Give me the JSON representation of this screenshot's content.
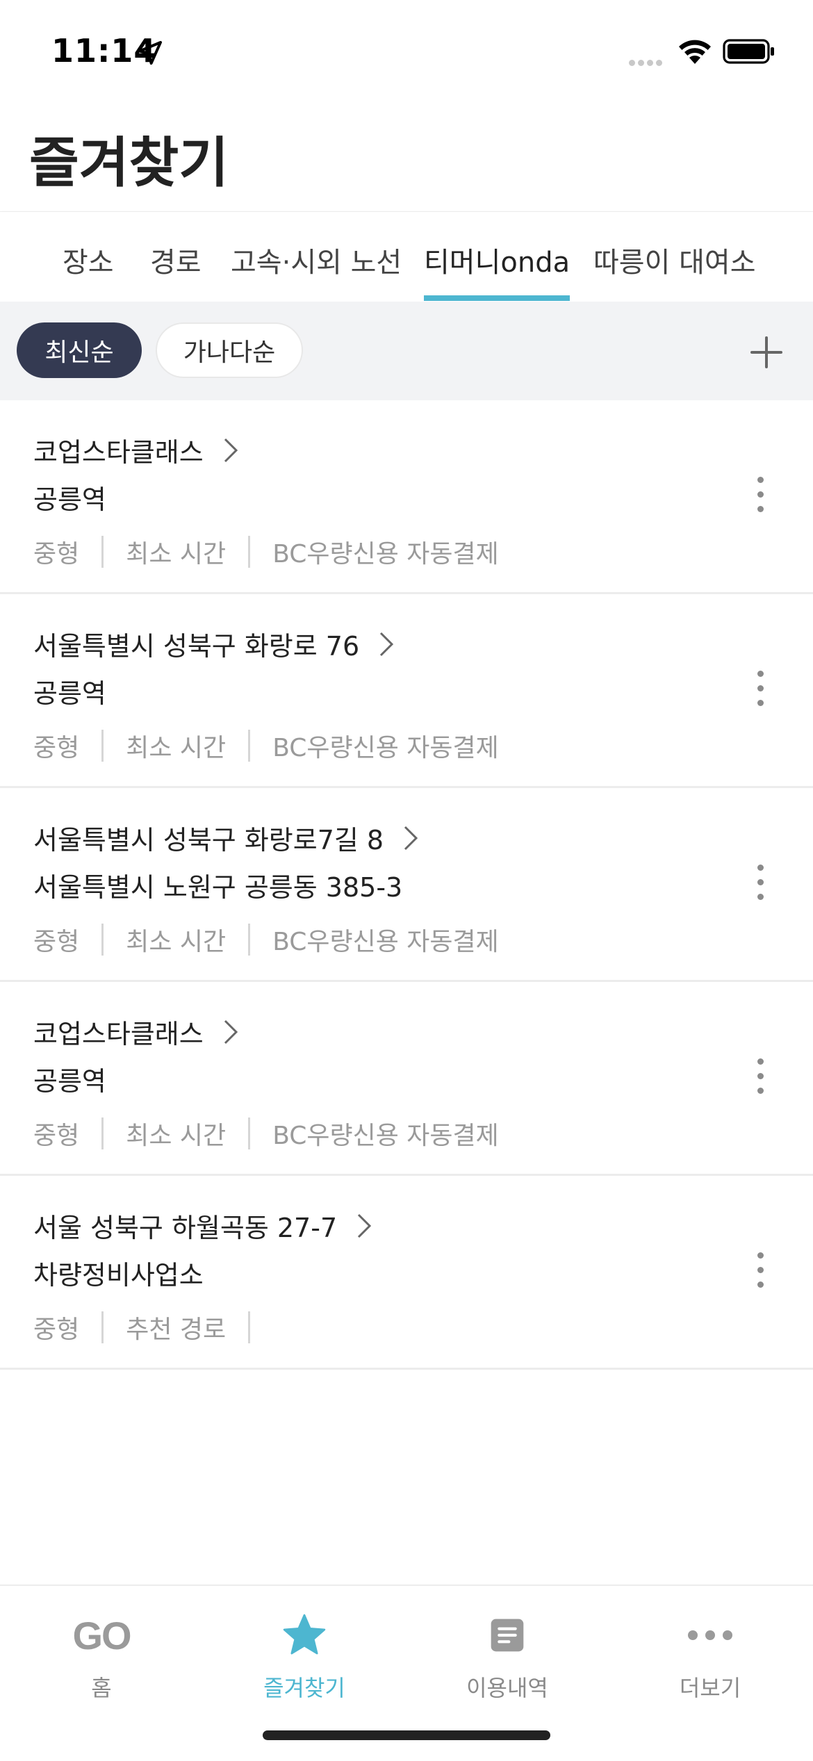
{
  "status_bar": {
    "time": "11:14"
  },
  "page_title": "즐겨찾기",
  "tabs": [
    {
      "label": "장소",
      "active": false
    },
    {
      "label": "경로",
      "active": false
    },
    {
      "label": "고속·시외 노선",
      "active": false
    },
    {
      "label": "티머니onda",
      "active": true
    },
    {
      "label": "따릉이 대여소",
      "active": false
    }
  ],
  "sort": {
    "latest": "최신순",
    "alphabetical": "가나다순"
  },
  "favorites": [
    {
      "title": "코업스타클래스",
      "subtitle": "공릉역",
      "meta": [
        "중형",
        "최소 시간",
        "BC우량신용 자동결제"
      ]
    },
    {
      "title": "서울특별시 성북구 화랑로 76",
      "subtitle": "공릉역",
      "meta": [
        "중형",
        "최소 시간",
        "BC우량신용 자동결제"
      ]
    },
    {
      "title": "서울특별시 성북구 화랑로7길 8",
      "subtitle": "서울특별시 노원구 공릉동 385-3",
      "meta": [
        "중형",
        "최소 시간",
        "BC우량신용 자동결제"
      ]
    },
    {
      "title": "코업스타클래스",
      "subtitle": "공릉역",
      "meta": [
        "중형",
        "최소 시간",
        "BC우량신용 자동결제"
      ]
    },
    {
      "title": "서울 성북구 하월곡동 27-7",
      "subtitle": "차량정비사업소",
      "meta": [
        "중형",
        "추천 경로",
        ""
      ]
    }
  ],
  "bottom_nav": [
    {
      "label": "홈",
      "icon": "go-logo-icon",
      "icon_text": "GO",
      "active": false
    },
    {
      "label": "즐겨찾기",
      "icon": "star-icon",
      "active": true
    },
    {
      "label": "이용내역",
      "icon": "document-icon",
      "active": false
    },
    {
      "label": "더보기",
      "icon": "more-horizontal-icon",
      "active": false
    }
  ],
  "colors": {
    "accent": "#4db6d0",
    "chip_selected": "#343a52",
    "sort_bar_bg": "#f2f3f5"
  }
}
